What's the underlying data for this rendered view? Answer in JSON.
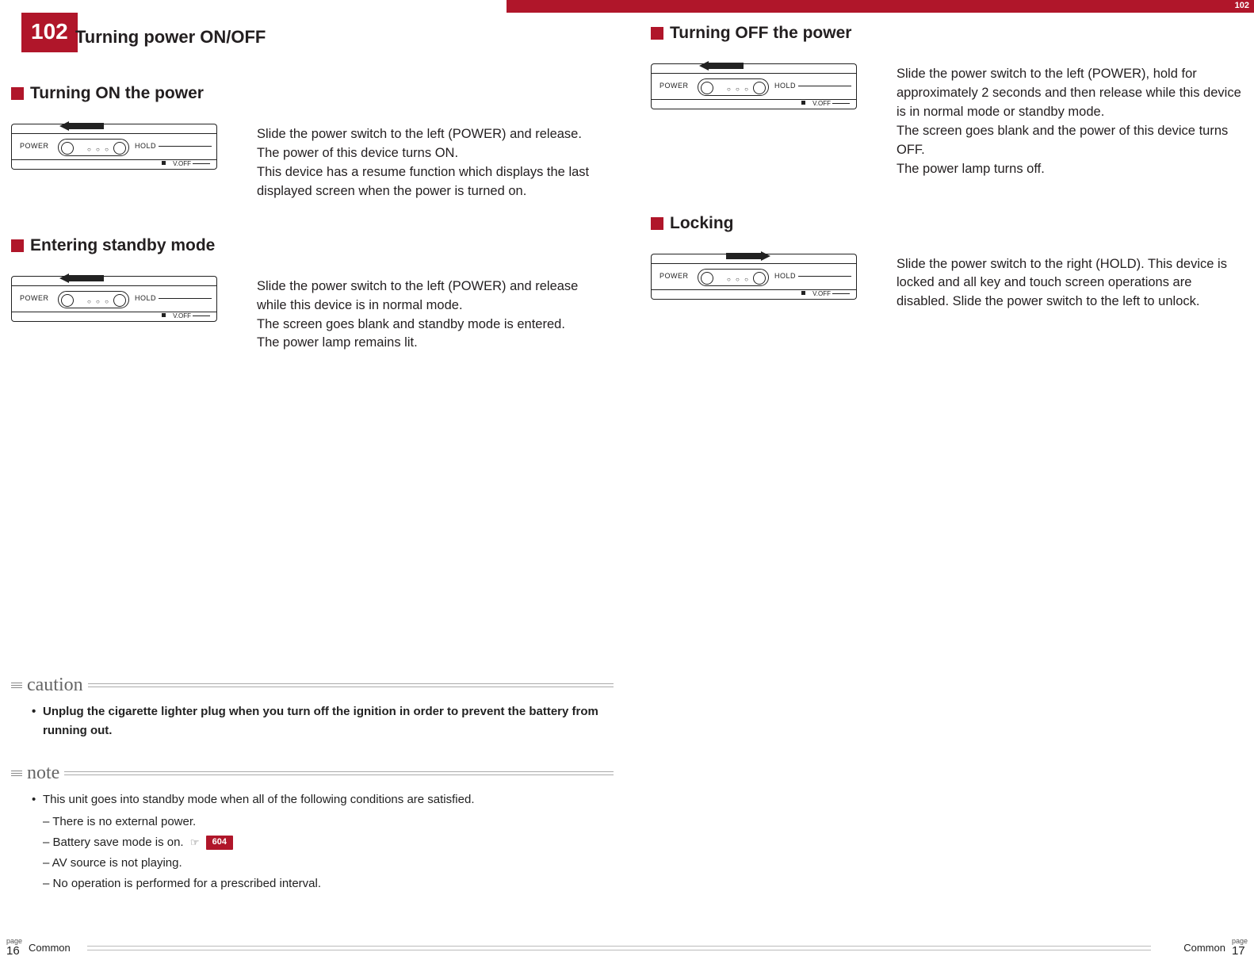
{
  "top_tab_number": "102",
  "page_number_badge": "102",
  "page_title": "Turning power ON/OFF",
  "sections": {
    "on": {
      "title": "Turning ON the power",
      "desc": "Slide the power switch to the left (POWER) and release.\nThe power of this device turns ON.\nThis device has a resume function which displays the last displayed screen when the power is turned on.",
      "arrow": "left"
    },
    "standby": {
      "title": "Entering standby mode",
      "desc": "Slide the power switch to the left (POWER) and release while this device is in normal mode.\nThe screen goes blank and standby mode is entered.\nThe power lamp remains lit.",
      "arrow": "left"
    },
    "off": {
      "title": "Turning OFF the power",
      "desc": "Slide the power switch to the left (POWER), hold for approximately 2 seconds and then release while this device is in normal mode or standby mode.\nThe screen goes blank and the power of this device turns OFF.\nThe power lamp turns off.",
      "arrow": "left"
    },
    "lock": {
      "title": "Locking",
      "desc": "Slide the power switch to the right (HOLD). This device is locked and all key and touch screen operations are disabled. Slide the power switch to the left to unlock.",
      "arrow": "right"
    }
  },
  "device_labels": {
    "power": "POWER",
    "hold": "HOLD",
    "voff": "V.OFF"
  },
  "caution": {
    "label": "caution",
    "item": "Unplug the cigarette lighter plug when you turn off the ignition in order to prevent the battery from running out."
  },
  "note": {
    "label": "note",
    "intro": "This unit goes into standby mode when all of the following conditions are satisfied.",
    "subs": [
      "– There is no external power.",
      "– Battery save mode is on.",
      "– AV source is not playing.",
      "– No operation is performed for a prescribed interval."
    ],
    "ref_icon": "☞",
    "ref_number": "604"
  },
  "footer": {
    "page_label": "page",
    "left_page": "16",
    "right_page": "17",
    "section": "Common"
  }
}
